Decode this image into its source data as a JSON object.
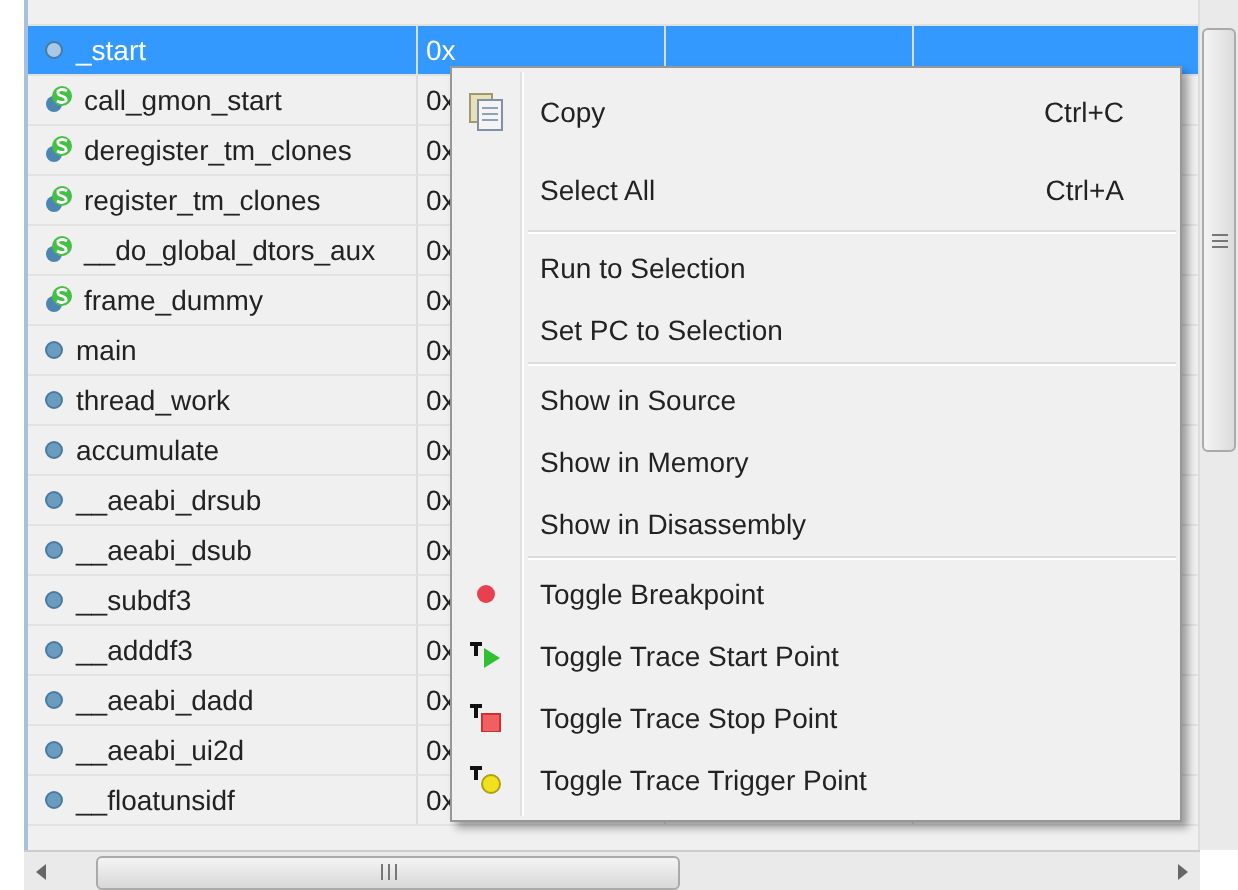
{
  "table": {
    "rows": [
      {
        "name": "_start",
        "value": "0x",
        "kind": "global",
        "selected": true
      },
      {
        "name": "call_gmon_start",
        "value": "0x",
        "kind": "static",
        "selected": false
      },
      {
        "name": "deregister_tm_clones",
        "value": "0x",
        "kind": "static",
        "selected": false
      },
      {
        "name": "register_tm_clones",
        "value": "0x",
        "kind": "static",
        "selected": false
      },
      {
        "name": "__do_global_dtors_aux",
        "value": "0x",
        "kind": "static",
        "selected": false
      },
      {
        "name": "frame_dummy",
        "value": "0x",
        "kind": "static",
        "selected": false
      },
      {
        "name": "main",
        "value": "0x",
        "kind": "global",
        "selected": false
      },
      {
        "name": "thread_work",
        "value": "0x",
        "kind": "global",
        "selected": false
      },
      {
        "name": "accumulate",
        "value": "0x",
        "kind": "global",
        "selected": false
      },
      {
        "name": "__aeabi_drsub",
        "value": "0x",
        "kind": "global",
        "selected": false
      },
      {
        "name": "__aeabi_dsub",
        "value": "0x",
        "kind": "global",
        "selected": false
      },
      {
        "name": "__subdf3",
        "value": "0x",
        "kind": "global",
        "selected": false
      },
      {
        "name": "__adddf3",
        "value": "0x",
        "kind": "global",
        "selected": false
      },
      {
        "name": "__aeabi_dadd",
        "value": "0x",
        "kind": "global",
        "selected": false
      },
      {
        "name": "__aeabi_ui2d",
        "value": "0x",
        "kind": "global",
        "selected": false
      },
      {
        "name": "__floatunsidf",
        "value": "0x",
        "kind": "global",
        "selected": false
      }
    ]
  },
  "context_menu": {
    "groups": [
      [
        {
          "label": "Copy",
          "shortcut": "Ctrl+C",
          "kind": "copy"
        },
        {
          "label": "Select All",
          "shortcut": "Ctrl+A",
          "kind": "plain"
        }
      ],
      [
        {
          "label": "Run to Selection",
          "kind": "plain"
        },
        {
          "label": "Set PC to Selection",
          "kind": "plain"
        }
      ],
      [
        {
          "label": "Show in Source",
          "kind": "plain"
        },
        {
          "label": "Show in Memory",
          "kind": "plain"
        },
        {
          "label": "Show in Disassembly",
          "kind": "plain"
        }
      ],
      [
        {
          "label": "Toggle Breakpoint",
          "kind": "breakpoint"
        },
        {
          "label": "Toggle Trace Start Point",
          "kind": "trace-start"
        },
        {
          "label": "Toggle Trace Stop Point",
          "kind": "trace-stop"
        },
        {
          "label": "Toggle Trace Trigger Point",
          "kind": "trace-trigger"
        }
      ]
    ]
  }
}
